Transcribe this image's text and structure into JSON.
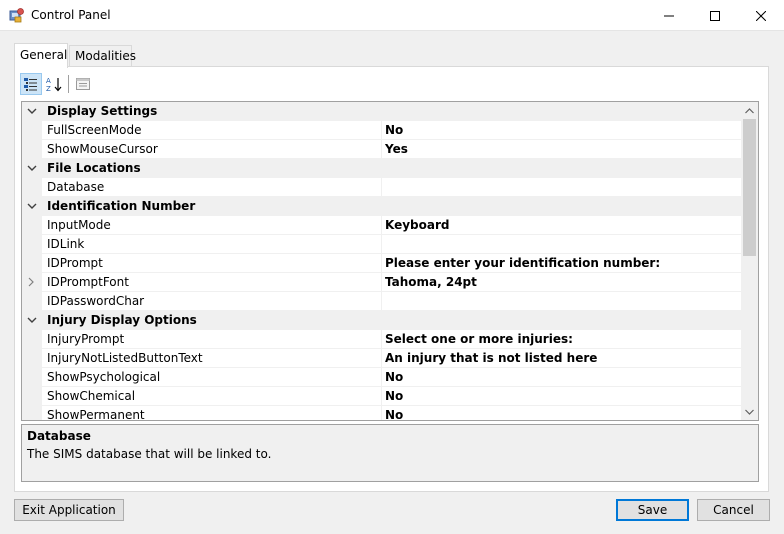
{
  "window": {
    "title": "Control Panel",
    "minimize_icon": "minimize-icon",
    "maximize_icon": "maximize-icon",
    "close_icon": "close-icon"
  },
  "tabs": [
    {
      "label": "General",
      "active": true
    },
    {
      "label": "Modalities",
      "active": false
    }
  ],
  "toolbar": {
    "categorized_icon": "categorized-icon",
    "alphabetical_icon": "alphabetical-icon",
    "property_pages_icon": "property-pages-icon"
  },
  "grid": {
    "categories": [
      {
        "label": "Display Settings",
        "properties": [
          {
            "name": "FullScreenMode",
            "value": "No"
          },
          {
            "name": "ShowMouseCursor",
            "value": "Yes"
          }
        ]
      },
      {
        "label": "File Locations",
        "properties": [
          {
            "name": "Database",
            "value": ""
          }
        ]
      },
      {
        "label": "Identification Number",
        "properties": [
          {
            "name": "InputMode",
            "value": "Keyboard"
          },
          {
            "name": "IDLink",
            "value": ""
          },
          {
            "name": "IDPrompt",
            "value": "Please enter your identification number:"
          },
          {
            "name": "IDPromptFont",
            "value": "Tahoma, 24pt"
          },
          {
            "name": "IDPasswordChar",
            "value": ""
          }
        ]
      },
      {
        "label": "Injury Display Options",
        "properties": [
          {
            "name": "InjuryPrompt",
            "value": "Select one or more injuries:"
          },
          {
            "name": "InjuryNotListedButtonText",
            "value": "An injury that is not listed here"
          },
          {
            "name": "ShowPsychological",
            "value": "No"
          },
          {
            "name": "ShowChemical",
            "value": "No"
          },
          {
            "name": "ShowPermanent",
            "value": "No"
          }
        ]
      }
    ]
  },
  "help": {
    "title": "Database",
    "description": "The SIMS database that will be linked to."
  },
  "buttons": {
    "exit": "Exit Application",
    "save": "Save",
    "cancel": "Cancel"
  },
  "colors": {
    "accent": "#0078d7",
    "toolbar_pressed": "#cce4f7",
    "category_bg": "#f0f0f0"
  }
}
